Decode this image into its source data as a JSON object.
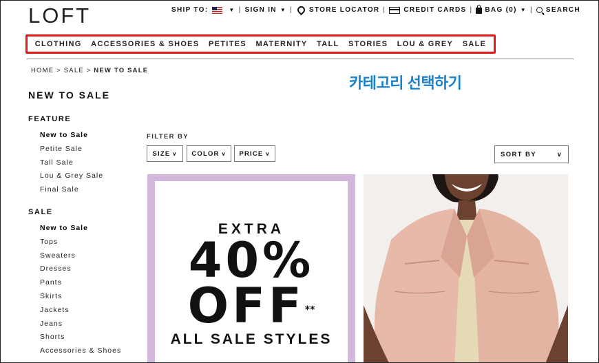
{
  "brand": {
    "logo": "LOFT"
  },
  "utility": {
    "ship_to": "SHIP TO:",
    "sign_in": "SIGN IN",
    "store_locator": "STORE LOCATOR",
    "credit_cards": "CREDIT CARDS",
    "bag": "BAG (0)",
    "search": "SEARCH"
  },
  "nav": {
    "items": [
      "CLOTHING",
      "ACCESSORIES & SHOES",
      "PETITES",
      "MATERNITY",
      "TALL",
      "STORIES",
      "LOU & GREY",
      "SALE"
    ],
    "highlight_color": "#e01818"
  },
  "breadcrumb": {
    "home": "HOME",
    "sep1": ">",
    "sale": "SALE",
    "sep2": ">",
    "current": "NEW TO SALE"
  },
  "annotation": {
    "text": "카테고리 선택하기",
    "color": "#1a80c8"
  },
  "page_title": "NEW TO SALE",
  "sidebar": {
    "feature_heading": "FEATURE",
    "feature_items": [
      "New to Sale",
      "Petite Sale",
      "Tall Sale",
      "Lou & Grey Sale",
      "Final Sale"
    ],
    "sale_heading": "SALE",
    "sale_items": [
      "New to Sale",
      "Tops",
      "Sweaters",
      "Dresses",
      "Pants",
      "Skirts",
      "Jackets",
      "Jeans",
      "Shorts",
      "Accessories & Shoes"
    ]
  },
  "filters": {
    "label": "FILTER BY",
    "size": "SIZE",
    "color": "COLOR",
    "price": "PRICE",
    "sort_by": "SORT BY"
  },
  "promo": {
    "line1": "EXTRA",
    "line2": "40%",
    "line3": "OFF",
    "footnote_mark": "**",
    "line4": "ALL SALE STYLES",
    "border_color": "#d3b7dc"
  },
  "product_image": {
    "icon": "model-in-pink-leather-jacket"
  }
}
